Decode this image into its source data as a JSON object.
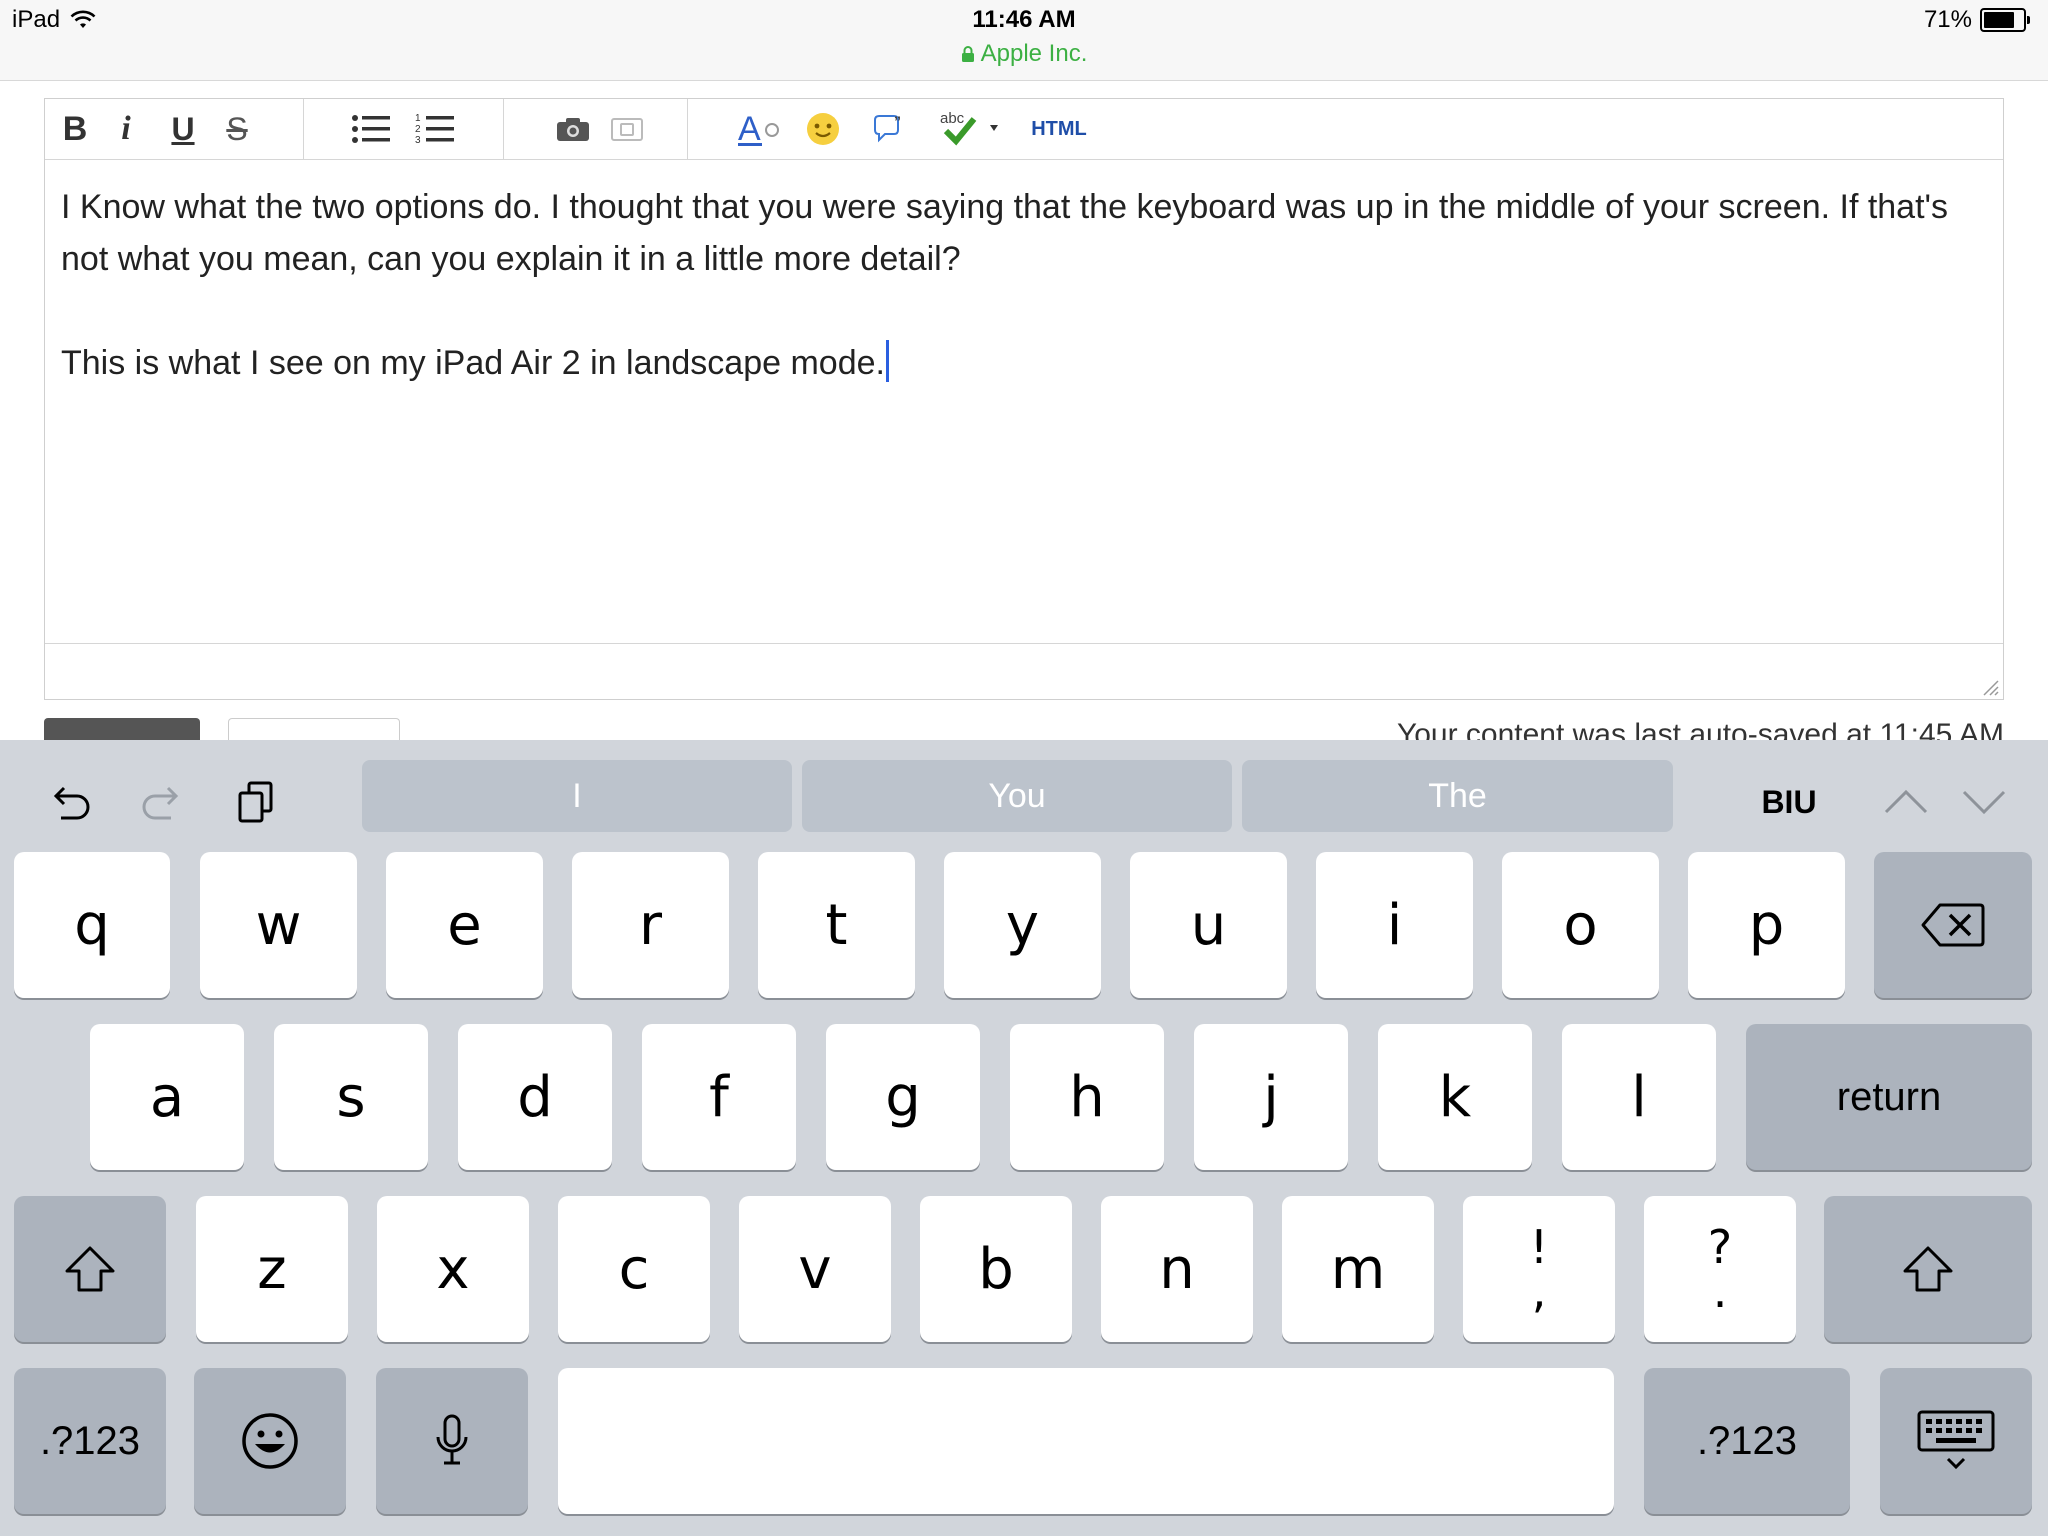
{
  "status_bar": {
    "device": "iPad",
    "time": "11:46 AM",
    "domain": "Apple Inc.",
    "battery": "71%",
    "battery_level": 0.71
  },
  "toolbar": {
    "bold": "B",
    "italic": "i",
    "underline": "U",
    "strike": "S",
    "html": "HTML",
    "spell_label": "abc"
  },
  "editor": {
    "paragraph1": "I Know what the two options do. I thought that you were saying that the keyboard was up in the middle of your screen. If that's not what you mean, can you explain it in a little more detail?",
    "paragraph2": "This is what I see on my iPad Air 2 in landscape mode."
  },
  "autosave_text": "Your content was last auto-saved at 11:45 AM",
  "keyboard": {
    "suggestions": [
      "I",
      "You",
      "The"
    ],
    "format_label": "BIU",
    "row1": [
      "q",
      "w",
      "e",
      "r",
      "t",
      "y",
      "u",
      "i",
      "o",
      "p"
    ],
    "row2": [
      "a",
      "s",
      "d",
      "f",
      "g",
      "h",
      "j",
      "k",
      "l"
    ],
    "row3": [
      "z",
      "x",
      "c",
      "v",
      "b",
      "n",
      "m"
    ],
    "punct1": [
      "!",
      ","
    ],
    "punct2": [
      "?",
      "."
    ],
    "return_label": "return",
    "numbers_label": ".?123"
  }
}
